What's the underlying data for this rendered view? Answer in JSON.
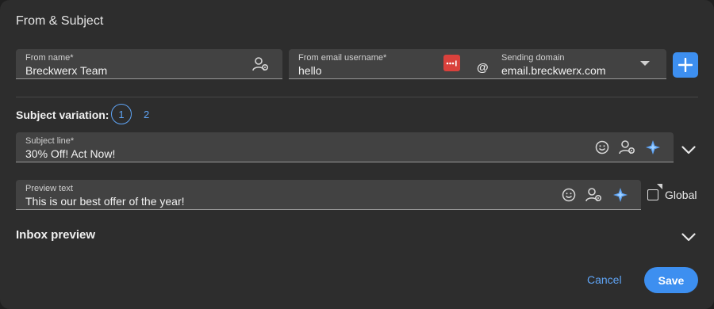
{
  "section_title": "From & Subject",
  "from_name": {
    "label": "From name*",
    "value": "Breckwerx Team"
  },
  "from_email": {
    "label": "From email username*",
    "value": "hello",
    "at_sign": "@"
  },
  "sending_domain": {
    "label": "Sending domain",
    "value": "email.breckwerx.com"
  },
  "subject_variation": {
    "label": "Subject variation:",
    "options": [
      "1",
      "2"
    ],
    "selected": "1"
  },
  "subject_line": {
    "label": "Subject line*",
    "value": "30% Off! Act Now!"
  },
  "preview_text": {
    "label": "Preview text",
    "value": "This is our best offer of the year!"
  },
  "global_label": "Global",
  "inbox_preview": "Inbox preview",
  "actions": {
    "cancel": "Cancel",
    "save": "Save"
  },
  "colors": {
    "accent": "#3d8ff0",
    "panel": "#2d2d2d",
    "field": "#424242",
    "password_badge": "#d9413c"
  }
}
